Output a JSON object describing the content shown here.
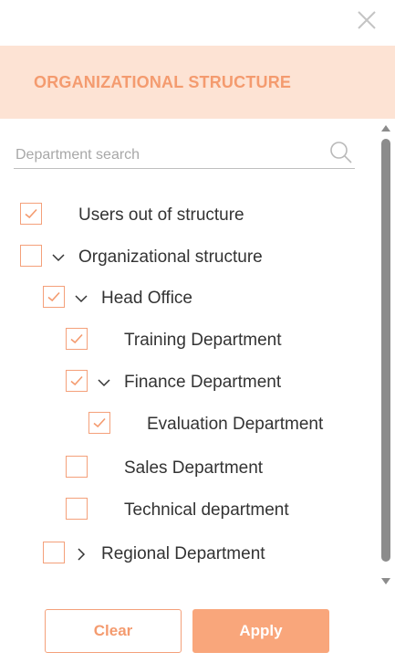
{
  "header": {
    "title": "ORGANIZATIONAL STRUCTURE"
  },
  "search": {
    "placeholder": "Department search",
    "value": ""
  },
  "tree": {
    "items": [
      {
        "label": "Users out of structure",
        "checked": true,
        "expander": "none",
        "level": 0
      },
      {
        "label": "Organizational structure",
        "checked": false,
        "expander": "expanded",
        "level": 0
      },
      {
        "label": "Head Office",
        "checked": true,
        "expander": "expanded",
        "level": 1
      },
      {
        "label": "Training Department",
        "checked": true,
        "expander": "none",
        "level": 2
      },
      {
        "label": "Finance Department",
        "checked": true,
        "expander": "expanded",
        "level": 2
      },
      {
        "label": "Evaluation Department",
        "checked": true,
        "expander": "none",
        "level": 3
      },
      {
        "label": "Sales Department",
        "checked": false,
        "expander": "none",
        "level": 2
      },
      {
        "label": "Technical department",
        "checked": false,
        "expander": "none",
        "level": 2
      },
      {
        "label": "Regional Department",
        "checked": false,
        "expander": "collapsed",
        "level": 1
      }
    ]
  },
  "buttons": {
    "clear": "Clear",
    "apply": "Apply"
  },
  "colors": {
    "accent": "#f49b6f",
    "header_bg": "#fde3d4",
    "apply_bg": "#f9a67b",
    "scroll_thumb": "#8c8c8c"
  },
  "icons": {
    "close": "close-icon",
    "search": "search-icon",
    "check": "check-icon",
    "expanded": "chevron-down-icon",
    "collapsed": "chevron-right-icon"
  }
}
